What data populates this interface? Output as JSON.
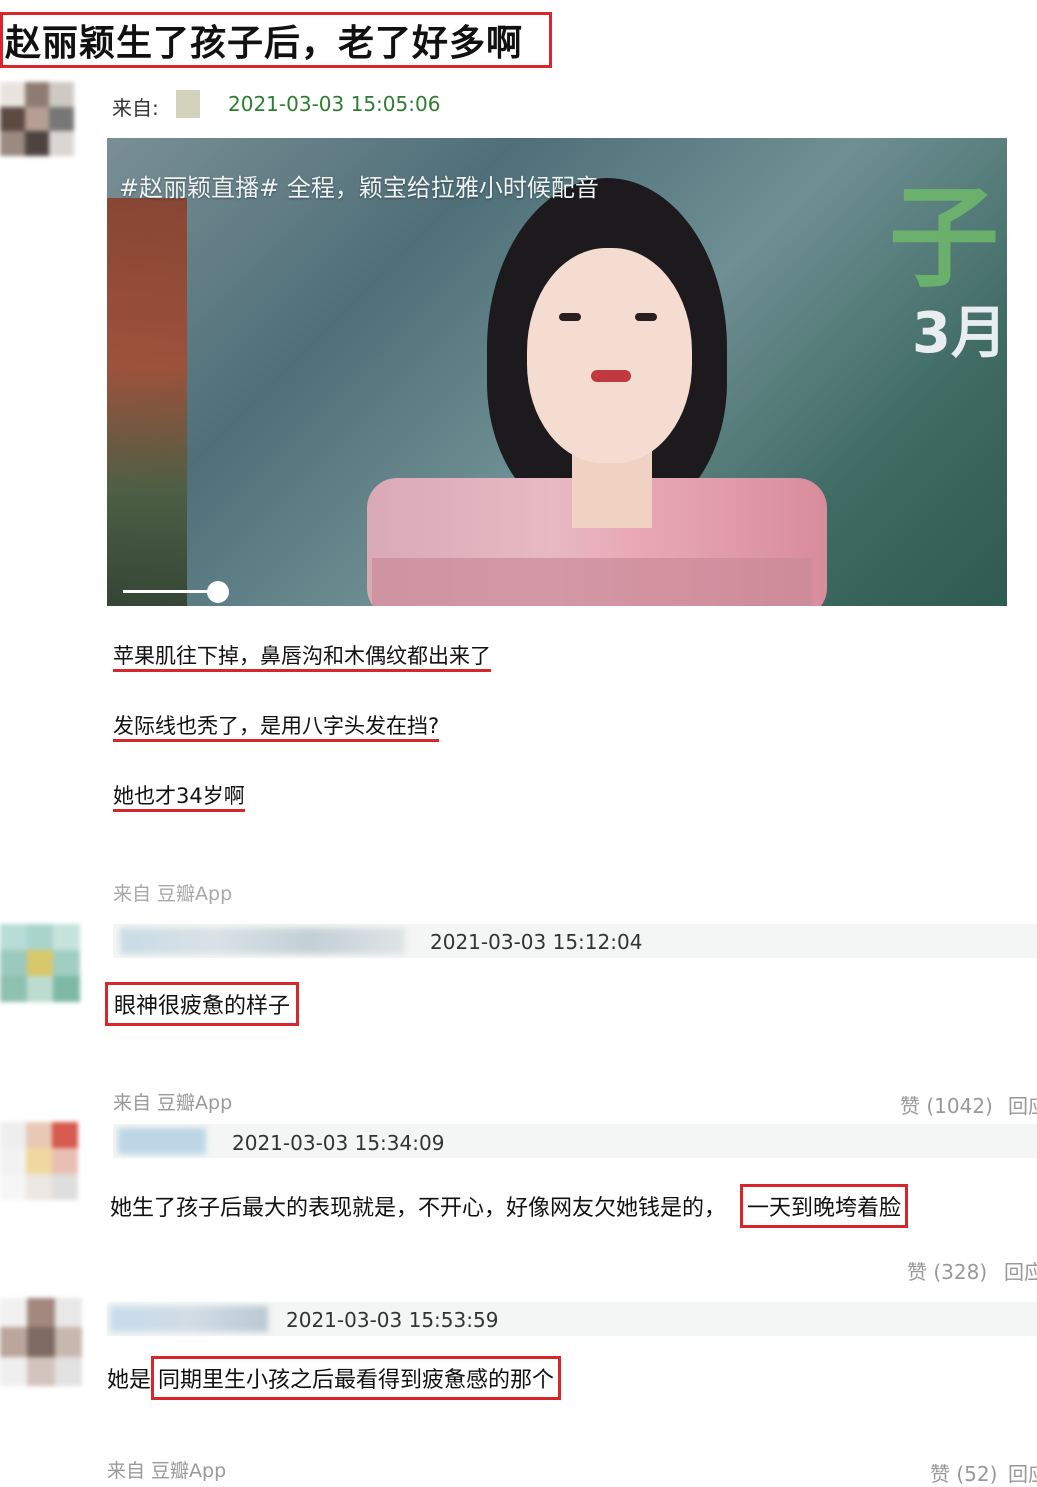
{
  "title": "赵丽颖生了孩子后，老了好多啊",
  "post": {
    "from_label": "来自:",
    "timestamp": "2021-03-03 15:05:06",
    "video": {
      "caption": "#赵丽颖直播# 全程，颖宝给拉雅小时候配音",
      "corner_text": "3月",
      "progress": 0.11
    },
    "lines": [
      "苹果肌往下掉，鼻唇沟和木偶纹都出来了",
      "发际线也秃了，是用八字头发在挡?",
      "她也才34岁啊"
    ],
    "source": "来自 豆瓣App"
  },
  "comments": [
    {
      "timestamp": "2021-03-03 15:12:04",
      "text": "眼神很疲惫的样子",
      "source": "来自 豆瓣App",
      "likes": "赞 (1042)",
      "reply": "回应"
    },
    {
      "timestamp": "2021-03-03 15:34:09",
      "text_prefix": "她生了孩子后最大的表现就是，不开心，好像网友欠她钱是的，",
      "text_highlight": "一天到晚垮着脸",
      "likes": "赞 (328)",
      "reply": "回应"
    },
    {
      "timestamp": "2021-03-03 15:53:59",
      "text_prefix": "她是",
      "text_highlight": "同期里生小孩之后最看得到疲惫感的那个",
      "source": "来自 豆瓣App",
      "likes": "赞 (52)",
      "reply": "回应"
    }
  ],
  "colors": {
    "highlight_red": "#d8262b",
    "timestamp_green": "#2e7d32",
    "muted_gray": "#999999"
  }
}
